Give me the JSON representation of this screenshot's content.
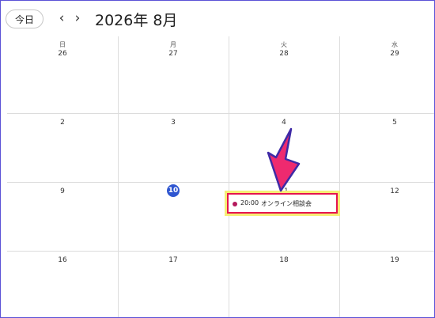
{
  "toolbar": {
    "today_label": "今日",
    "prev_icon": "chevron-left-icon",
    "next_icon": "chevron-right-icon",
    "prev_glyph": "‹",
    "next_glyph": "›",
    "month_title": "2026年 8月"
  },
  "weekdays": [
    "日",
    "月",
    "火",
    "水"
  ],
  "weeks": [
    [
      "26",
      "27",
      "28",
      "29"
    ],
    [
      "2",
      "3",
      "4",
      "5"
    ],
    [
      "9",
      "10",
      "11",
      "12"
    ],
    [
      "16",
      "17",
      "18",
      "19"
    ]
  ],
  "event": {
    "time": "20:00",
    "title": "オンライン相談会",
    "dot_color": "#b4195c"
  },
  "colors": {
    "today_highlight": "#2f56d0",
    "annotation_arrow": "#ee2a6f",
    "annotation_box": "#e5144f",
    "annotation_glow": "#f6ee76",
    "border": "#5b52d6"
  }
}
